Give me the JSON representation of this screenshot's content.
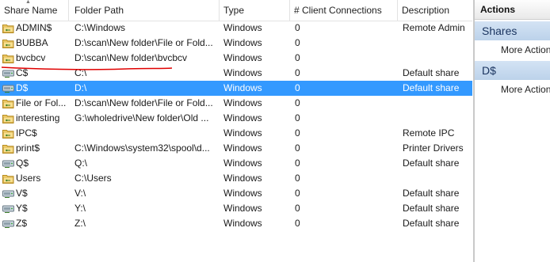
{
  "columns": {
    "name": "Share Name",
    "path": "Folder Path",
    "type": "Type",
    "connections": "# Client Connections",
    "description": "Description"
  },
  "shares": [
    {
      "name": "ADMIN$",
      "path": "C:\\Windows",
      "type": "Windows",
      "connections": "0",
      "description": "Remote Admin"
    },
    {
      "name": "BUBBA",
      "path": "D:\\scan\\New folder\\File or Fold...",
      "type": "Windows",
      "connections": "0",
      "description": ""
    },
    {
      "name": "bvcbcv",
      "path": "D:\\scan\\New folder\\bvcbcv",
      "type": "Windows",
      "connections": "0",
      "description": ""
    },
    {
      "name": "C$",
      "path": "C:\\",
      "type": "Windows",
      "connections": "0",
      "description": "Default share"
    },
    {
      "name": "D$",
      "path": "D:\\",
      "type": "Windows",
      "connections": "0",
      "description": "Default share"
    },
    {
      "name": "File or Fol...",
      "path": "D:\\scan\\New folder\\File or Fold...",
      "type": "Windows",
      "connections": "0",
      "description": ""
    },
    {
      "name": "interesting",
      "path": "G:\\wholedrive\\New folder\\Old ...",
      "type": "Windows",
      "connections": "0",
      "description": ""
    },
    {
      "name": "IPC$",
      "path": "",
      "type": "Windows",
      "connections": "0",
      "description": "Remote IPC"
    },
    {
      "name": "print$",
      "path": "C:\\Windows\\system32\\spool\\d...",
      "type": "Windows",
      "connections": "0",
      "description": "Printer Drivers"
    },
    {
      "name": "Q$",
      "path": "Q:\\",
      "type": "Windows",
      "connections": "0",
      "description": "Default share"
    },
    {
      "name": "Users",
      "path": "C:\\Users",
      "type": "Windows",
      "connections": "0",
      "description": ""
    },
    {
      "name": "V$",
      "path": "V:\\",
      "type": "Windows",
      "connections": "0",
      "description": "Default share"
    },
    {
      "name": "Y$",
      "path": "Y:\\",
      "type": "Windows",
      "connections": "0",
      "description": "Default share"
    },
    {
      "name": "Z$",
      "path": "Z:\\",
      "type": "Windows",
      "connections": "0",
      "description": "Default share"
    }
  ],
  "selected_share": "D$",
  "actions": {
    "title": "Actions",
    "sections": [
      {
        "heading": "Shares",
        "item": "More Actions"
      },
      {
        "heading": "D$",
        "item": "More Actions"
      }
    ]
  },
  "colors": {
    "selection": "#3399ff",
    "annotation": "#e00000"
  }
}
